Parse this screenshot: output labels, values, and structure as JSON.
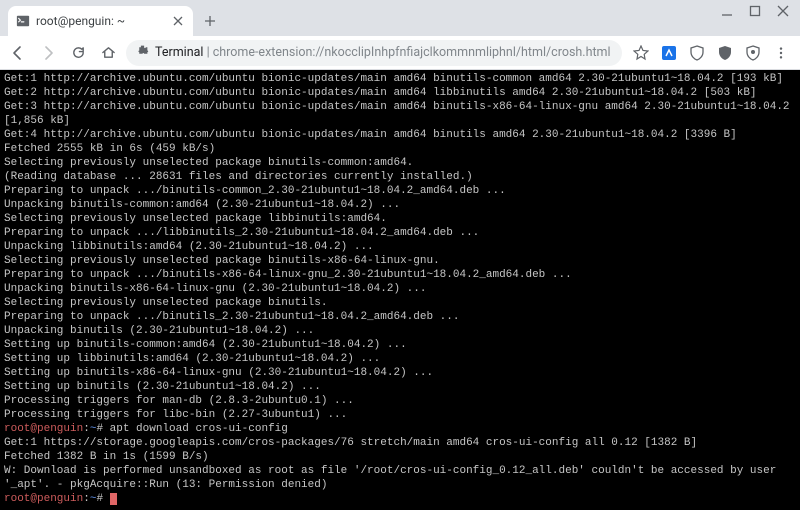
{
  "tab": {
    "title": "root@penguin: ~"
  },
  "omnibox": {
    "prefix": "Terminal",
    "rest": " | chrome-extension://nkocclipInhpfnfiajclkommnmliphnl/html/crosh.html"
  },
  "terminal": {
    "lines": [
      "Get:1 http://archive.ubuntu.com/ubuntu bionic-updates/main amd64 binutils-common amd64 2.30-21ubuntu1~18.04.2 [193 kB]",
      "Get:2 http://archive.ubuntu.com/ubuntu bionic-updates/main amd64 libbinutils amd64 2.30-21ubuntu1~18.04.2 [503 kB]",
      "Get:3 http://archive.ubuntu.com/ubuntu bionic-updates/main amd64 binutils-x86-64-linux-gnu amd64 2.30-21ubuntu1~18.04.2 [1,856 kB]",
      "Get:4 http://archive.ubuntu.com/ubuntu bionic-updates/main amd64 binutils amd64 2.30-21ubuntu1~18.04.2 [3396 B]",
      "Fetched 2555 kB in 6s (459 kB/s)",
      "Selecting previously unselected package binutils-common:amd64.",
      "(Reading database ... 28631 files and directories currently installed.)",
      "Preparing to unpack .../binutils-common_2.30-21ubuntu1~18.04.2_amd64.deb ...",
      "Unpacking binutils-common:amd64 (2.30-21ubuntu1~18.04.2) ...",
      "Selecting previously unselected package libbinutils:amd64.",
      "Preparing to unpack .../libbinutils_2.30-21ubuntu1~18.04.2_amd64.deb ...",
      "Unpacking libbinutils:amd64 (2.30-21ubuntu1~18.04.2) ...",
      "Selecting previously unselected package binutils-x86-64-linux-gnu.",
      "Preparing to unpack .../binutils-x86-64-linux-gnu_2.30-21ubuntu1~18.04.2_amd64.deb ...",
      "Unpacking binutils-x86-64-linux-gnu (2.30-21ubuntu1~18.04.2) ...",
      "Selecting previously unselected package binutils.",
      "Preparing to unpack .../binutils_2.30-21ubuntu1~18.04.2_amd64.deb ...",
      "Unpacking binutils (2.30-21ubuntu1~18.04.2) ...",
      "Setting up binutils-common:amd64 (2.30-21ubuntu1~18.04.2) ...",
      "Setting up libbinutils:amd64 (2.30-21ubuntu1~18.04.2) ...",
      "Setting up binutils-x86-64-linux-gnu (2.30-21ubuntu1~18.04.2) ...",
      "Setting up binutils (2.30-21ubuntu1~18.04.2) ...",
      "Processing triggers for man-db (2.8.3-2ubuntu0.1) ...",
      "Processing triggers for libc-bin (2.27-3ubuntu1) ..."
    ],
    "prompt1": {
      "user": "root@penguin",
      "path": "~",
      "cmd": "apt download cros-ui-config"
    },
    "after1": [
      "Get:1 https://storage.googleapis.com/cros-packages/76 stretch/main amd64 cros-ui-config all 0.12 [1382 B]",
      "Fetched 1382 B in 1s (1599 B/s)",
      "W: Download is performed unsandboxed as root as file '/root/cros-ui-config_0.12_all.deb' couldn't be accessed by user '_apt'. - pkgAcquire::Run (13: Permission denied)"
    ],
    "prompt2": {
      "user": "root@penguin",
      "path": "~",
      "cmd": ""
    }
  }
}
